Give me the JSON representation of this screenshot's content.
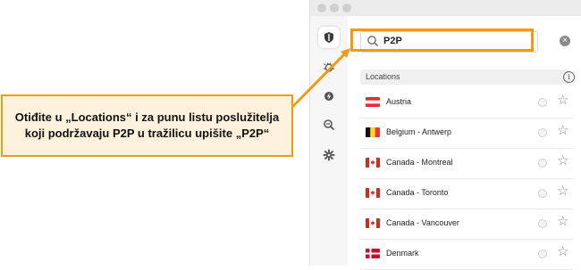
{
  "colors": {
    "accent": "#f39a11",
    "callout_bg": "#fff2dc"
  },
  "sidebar": {
    "items": [
      {
        "icon": "shield-icon",
        "active": true
      },
      {
        "icon": "bug-icon"
      },
      {
        "icon": "lightning-icon"
      },
      {
        "icon": "search-zoom-icon"
      },
      {
        "icon": "gear-icon"
      }
    ]
  },
  "search": {
    "value": "P2P"
  },
  "locations": {
    "header": "Locations",
    "info_icon": "i",
    "items": [
      {
        "label": "Austria",
        "flag": "austria"
      },
      {
        "label": "Belgium - Antwerp",
        "flag": "belgium"
      },
      {
        "label": "Canada - Montreal",
        "flag": "canada"
      },
      {
        "label": "Canada - Toronto",
        "flag": "canada"
      },
      {
        "label": "Canada - Vancouver",
        "flag": "canada"
      },
      {
        "label": "Denmark",
        "flag": "denmark"
      }
    ]
  },
  "callout": {
    "text": "Otiđite u „Locations“ i za punu listu poslužitelja koji podržavaju P2P u tražilicu upišite „P2P“"
  }
}
